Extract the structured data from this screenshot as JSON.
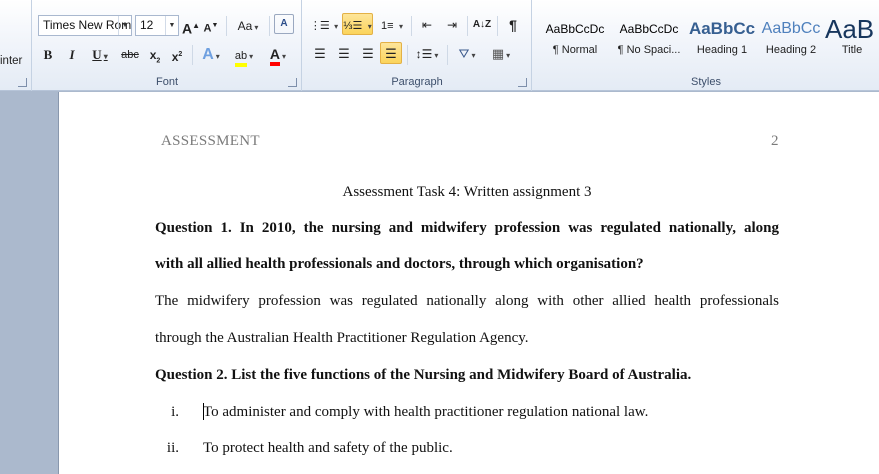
{
  "clipboard": {
    "partial_label": "inter"
  },
  "font": {
    "label": "Font",
    "name": "Times New Rom",
    "size": "12",
    "grow_label": "A",
    "shrink_label": "A",
    "case_label": "Aa",
    "clear_label": "A",
    "bold": "B",
    "italic": "I",
    "underline": "U",
    "strike": "abc",
    "subscript": "x",
    "superscript": "x",
    "effects_label": "A",
    "highlight_label": "ab",
    "color_label": "A"
  },
  "paragraph": {
    "label": "Paragraph",
    "pilcrow": "¶"
  },
  "styles": {
    "label": "Styles",
    "items": [
      {
        "sample": "AaBbCcDc",
        "name": "¶ Normal"
      },
      {
        "sample": "AaBbCcDc",
        "name": "¶ No Spaci..."
      },
      {
        "sample": "AaBbCc",
        "name": "Heading 1"
      },
      {
        "sample": "AaBbCc",
        "name": "Heading 2"
      },
      {
        "sample": "AaB",
        "name": "Title"
      }
    ]
  },
  "colors": {
    "highlight": "#ffff00",
    "font_color": "#ff0000",
    "heading": "#17365d",
    "active": "#fbd45b"
  },
  "document": {
    "header_left": "ASSESSMENT",
    "page_number": "2",
    "title": "Assessment Task 4: Written assignment 3",
    "q1_line1": "Question 1. In 2010, the nursing and midwifery profession was regulated nationally, along",
    "q1_line2": "with all allied health professionals and doctors, through which organisation?",
    "a1_line1": "The midwifery profession was regulated nationally along with other allied health professionals",
    "a1_line2": "through the Australian Health Practitioner Regulation Agency.",
    "q2": "Question 2. List the five functions of the Nursing and Midwifery Board of Australia.",
    "list": [
      {
        "num": "i.",
        "text": "To administer and comply with health practitioner regulation national law."
      },
      {
        "num": "ii.",
        "text": "To protect health and safety of the public."
      }
    ]
  }
}
